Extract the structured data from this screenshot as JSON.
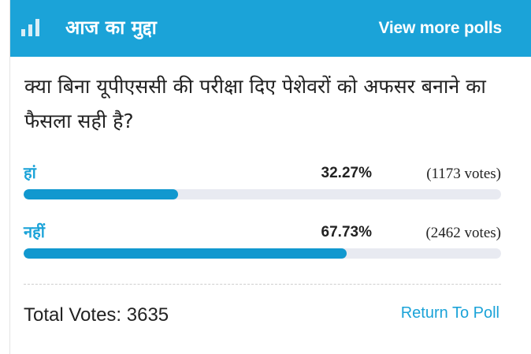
{
  "header": {
    "title": "आज का मुद्दा",
    "more_link": "View more polls",
    "icon": "poll-bars-icon"
  },
  "question": "क्या बिना यूपीएससी की परीक्षा दिए पेशेवरों को अफसर बनाने का फैसला सही है?",
  "options": [
    {
      "label": "हां",
      "percent": "32.27%",
      "votes": "(1173 votes)",
      "fill": 0.3227
    },
    {
      "label": "नहीं",
      "percent": "67.73%",
      "votes": "(2462 votes)",
      "fill": 0.6773
    }
  ],
  "footer": {
    "total": "Total Votes: 3635",
    "return_link": "Return To Poll"
  },
  "colors": {
    "accent": "#1ba3d8",
    "bar_fill": "#1198cf",
    "bar_track": "#e8eaf1"
  }
}
